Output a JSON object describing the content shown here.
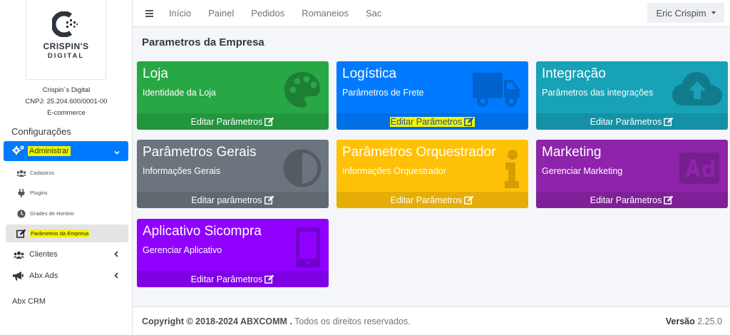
{
  "sidebar": {
    "logo": {
      "name": "CRISPIN'S",
      "sub": "DIGITAL"
    },
    "company": {
      "line1": "Crispin´s Digital",
      "line2": "CNPJ: 25.204.600/0001-00",
      "line3": "E-commerce"
    },
    "section_header": "Configurações",
    "active_item": {
      "label": "Administrar",
      "icon": "cogs-icon"
    },
    "sub_items": [
      {
        "label": "Cadastros",
        "icon": "users-icon"
      },
      {
        "label": "Plugins",
        "icon": "plug-icon"
      },
      {
        "label": "Grades de Horário",
        "icon": "clock-icon"
      },
      {
        "label": "Parâmetros da Empresa",
        "icon": "edit-icon"
      }
    ],
    "items": [
      {
        "label": "Clientes",
        "icon": "users-icon"
      },
      {
        "label": "Abx Ads",
        "icon": "bullhorn-icon"
      }
    ],
    "cut_item": "Abx CRM"
  },
  "topbar": {
    "links": [
      "Início",
      "Painel",
      "Pedidos",
      "Romaneios",
      "Sac"
    ],
    "user": "Eric Crispim"
  },
  "page": {
    "title": "Parametros da Empresa"
  },
  "cards": [
    {
      "title": "Loja",
      "subtitle": "Identidade da Loja",
      "footer": "Editar Parâmetros",
      "color": "#28a745",
      "icon": "palette-icon"
    },
    {
      "title": "Logística",
      "subtitle": "Parâmetros de Frete",
      "footer": "Editar Parâmetros",
      "color": "#007bff",
      "icon": "truck-icon"
    },
    {
      "title": "Integração",
      "subtitle": "Parâmetros das integrações",
      "footer": "Editar Parâmetros",
      "color": "#17a2b8",
      "icon": "cloud-upload-icon"
    },
    {
      "title": "Parâmetros Gerais",
      "subtitle": "Informações Gerais",
      "footer": "Editar parâmetros",
      "color": "#6c757d",
      "icon": "adjust-icon"
    },
    {
      "title": "Parâmetros Orquestrador",
      "subtitle": "Informações Orquestrador",
      "footer": "Editar Parâmetros",
      "color": "#ffc107",
      "icon": "info-icon"
    },
    {
      "title": "Marketing",
      "subtitle": "Gerenciar Marketing",
      "footer": "Editar Parâmetros",
      "color": "#8e24aa",
      "icon": "ad-icon"
    },
    {
      "title": "Aplicativo Sicompra",
      "subtitle": "Gerenciar Aplicativo",
      "footer": "Editar Parâmetros",
      "color": "#8f00ff",
      "icon": "tablet-icon"
    }
  ],
  "footer": {
    "copyright": "Copyright © 2018-2024 ABXCOMM .",
    "rights": "Todos os direitos reservados.",
    "version_label": "Versão",
    "version": "2.25.0"
  }
}
